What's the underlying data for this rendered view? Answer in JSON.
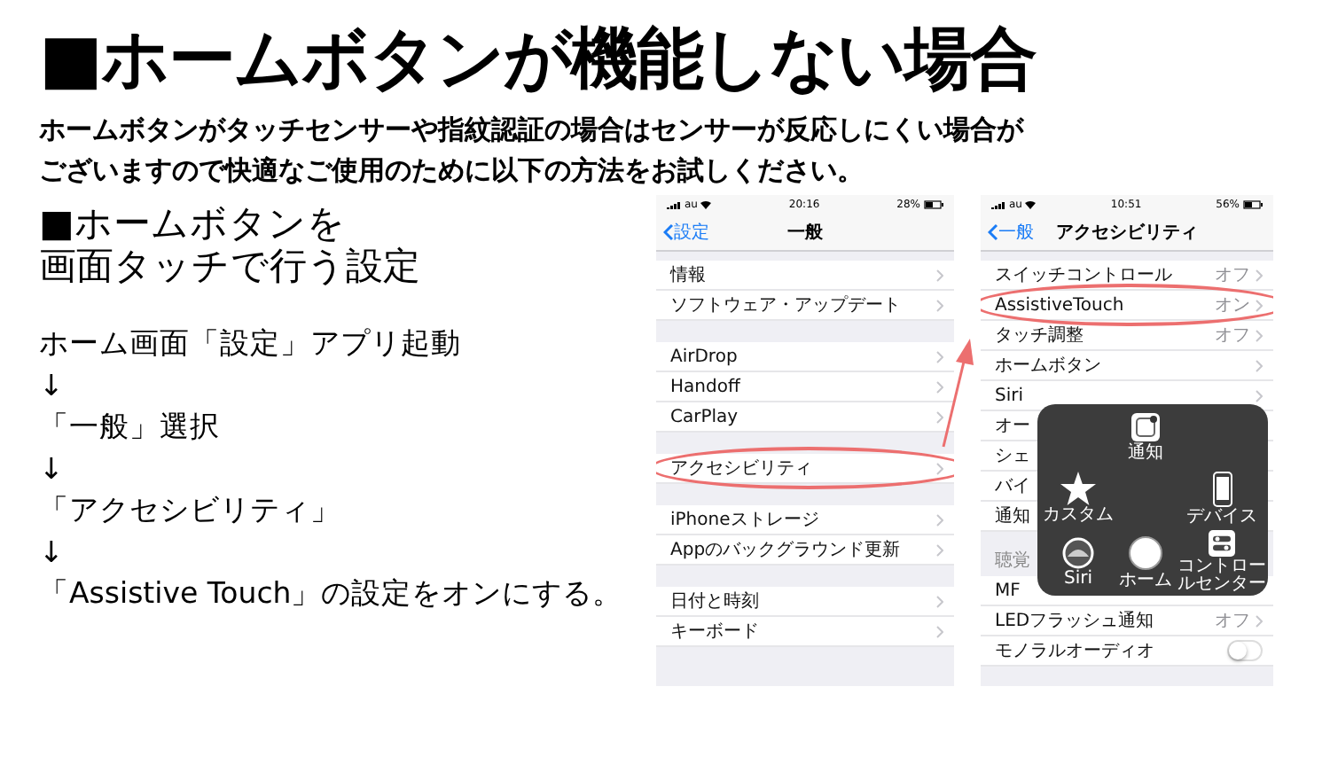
{
  "title": "■ホームボタンが機能しない場合",
  "intro": [
    "ホームボタンがタッチセンサーや指紋認証の場合はセンサーが反応しにくい場合が",
    "ございますので快適なご使用のために以下の方法をお試しください。"
  ],
  "section_heading": [
    "■ホームボタンを",
    "画面タッチで行う設定"
  ],
  "steps": [
    "ホーム画面「設定」アプリ起動",
    "↓",
    "「一般」選択",
    "↓",
    "「アクセシビリティ」",
    "↓",
    "「Assistive Touch」の設定をオンにする。"
  ],
  "phones": [
    {
      "status": {
        "carrier": "au",
        "time": "20:16",
        "battery": "28%"
      },
      "nav": {
        "back": "設定",
        "title": "一般"
      },
      "groups": [
        {
          "rows": [
            {
              "kind": "link",
              "label": "情報",
              "highlighted": false
            },
            {
              "kind": "link",
              "label": "ソフトウェア・アップデート",
              "highlighted": false
            }
          ]
        },
        {
          "rows": [
            {
              "kind": "link",
              "label": "AirDrop",
              "highlighted": false
            },
            {
              "kind": "link",
              "label": "Handoff",
              "highlighted": false
            },
            {
              "kind": "link",
              "label": "CarPlay",
              "highlighted": false
            }
          ]
        },
        {
          "rows": [
            {
              "kind": "link",
              "label": "アクセシビリティ",
              "highlighted": true
            }
          ]
        },
        {
          "rows": [
            {
              "kind": "link",
              "label": "iPhoneストレージ",
              "highlighted": false
            },
            {
              "kind": "link",
              "label": "Appのバックグラウンド更新",
              "highlighted": false
            }
          ]
        },
        {
          "rows": [
            {
              "kind": "link",
              "label": "日付と時刻",
              "highlighted": false
            },
            {
              "kind": "link",
              "label": "キーボード",
              "highlighted": false
            }
          ]
        }
      ]
    },
    {
      "status": {
        "carrier": "au",
        "time": "10:51",
        "battery": "56%"
      },
      "nav": {
        "back": "一般",
        "title": "アクセシビリティ"
      },
      "groups": [
        {
          "rows": [
            {
              "kind": "link",
              "label": "スイッチコントロール",
              "value": "オフ",
              "highlighted": false
            },
            {
              "kind": "link",
              "label": "AssistiveTouch",
              "value": "オン",
              "highlighted": true
            },
            {
              "kind": "link",
              "label": "タッチ調整",
              "value": "オフ",
              "highlighted": false
            },
            {
              "kind": "link",
              "label": "ホームボタン",
              "highlighted": false
            },
            {
              "kind": "link",
              "label": "Siri",
              "highlighted": false
            },
            {
              "kind": "covered",
              "label": "オー",
              "highlighted": false
            },
            {
              "kind": "covered",
              "label": "シェ",
              "highlighted": false
            },
            {
              "kind": "covered",
              "label": "バイ",
              "highlighted": false
            },
            {
              "kind": "covered",
              "label": "通知",
              "highlighted": false
            }
          ]
        },
        {
          "header": "聴覚",
          "rows": [
            {
              "kind": "covered",
              "label": "MF",
              "highlighted": false
            },
            {
              "kind": "link",
              "label": "LEDフラッシュ通知",
              "value": "オフ",
              "highlighted": false
            },
            {
              "kind": "toggle",
              "label": "モノラルオーディオ",
              "on": false,
              "highlighted": false
            }
          ]
        }
      ],
      "assistive_menu": {
        "items": [
          {
            "kind": "notification",
            "label": "通知"
          },
          {
            "kind": "star",
            "label": "カスタム"
          },
          {
            "kind": "device",
            "label": "デバイス"
          },
          {
            "kind": "siri",
            "label": "Siri"
          },
          {
            "kind": "home",
            "label": "ホーム"
          },
          {
            "kind": "control",
            "label": "コントロールセンター"
          }
        ]
      }
    }
  ]
}
